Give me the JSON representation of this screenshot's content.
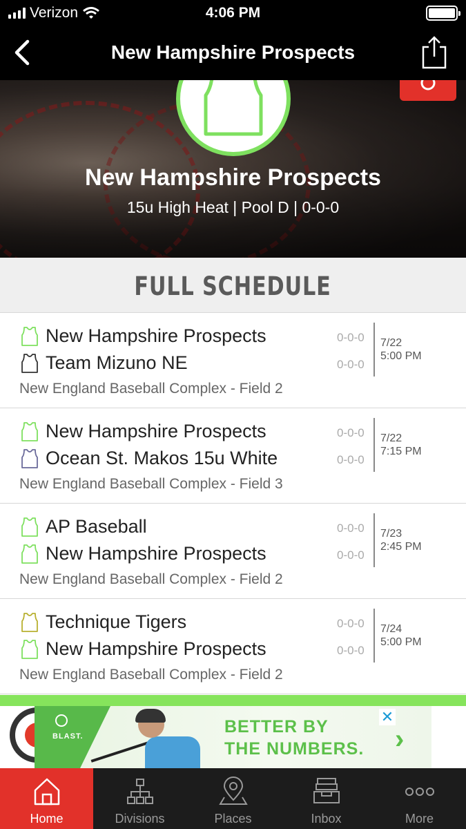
{
  "status_bar": {
    "carrier": "Verizon",
    "time": "4:06 PM"
  },
  "nav": {
    "title": "New Hampshire Prospects"
  },
  "hero": {
    "team_name": "New Hampshire Prospects",
    "subtitle": "15u High Heat | Pool D | 0-0-0"
  },
  "schedule": {
    "header": "FULL SCHEDULE",
    "games": [
      {
        "team1": {
          "name": "New Hampshire Prospects",
          "record": "0-0-0",
          "jersey_color": "#7ee05f"
        },
        "team2": {
          "name": "Team Mizuno NE",
          "record": "0-0-0",
          "jersey_color": "#333333"
        },
        "date": "7/22",
        "time": "5:00 PM",
        "venue": "New England Baseball Complex - Field 2"
      },
      {
        "team1": {
          "name": "New Hampshire Prospects",
          "record": "0-0-0",
          "jersey_color": "#7ee05f"
        },
        "team2": {
          "name": "Ocean St. Makos 15u White",
          "record": "0-0-0",
          "jersey_color": "#6a6a9a"
        },
        "date": "7/22",
        "time": "7:15 PM",
        "venue": "New England Baseball Complex - Field 3"
      },
      {
        "team1": {
          "name": "AP Baseball",
          "record": "0-0-0",
          "jersey_color": "#7ee05f"
        },
        "team2": {
          "name": "New Hampshire Prospects",
          "record": "0-0-0",
          "jersey_color": "#7ee05f"
        },
        "date": "7/23",
        "time": "2:45 PM",
        "venue": "New England Baseball Complex - Field 2"
      },
      {
        "team1": {
          "name": "Technique Tigers",
          "record": "0-0-0",
          "jersey_color": "#b8b030"
        },
        "team2": {
          "name": "New Hampshire Prospects",
          "record": "0-0-0",
          "jersey_color": "#7ee05f"
        },
        "date": "7/24",
        "time": "5:00 PM",
        "venue": "New England Baseball Complex - Field 2"
      }
    ]
  },
  "ad": {
    "brand": "BLAST.",
    "line1": "BETTER BY",
    "line2": "THE NUMBERS."
  },
  "tabs": [
    {
      "label": "Home",
      "icon": "home-icon",
      "active": true
    },
    {
      "label": "Divisions",
      "icon": "divisions-icon",
      "active": false
    },
    {
      "label": "Places",
      "icon": "places-icon",
      "active": false
    },
    {
      "label": "Inbox",
      "icon": "inbox-icon",
      "active": false
    },
    {
      "label": "More",
      "icon": "more-icon",
      "active": false
    }
  ],
  "colors": {
    "accent_red": "#e2312a",
    "team_green": "#7ee05f",
    "ad_green": "#5cc04a"
  }
}
